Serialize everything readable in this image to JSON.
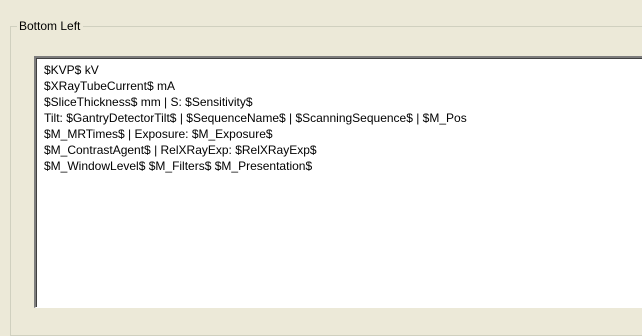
{
  "groupbox": {
    "caption": "Bottom Left"
  },
  "editor": {
    "lines": [
      "$KVP$ kV",
      "$XRayTubeCurrent$ mA",
      "$SliceThickness$ mm | S: $Sensitivity$",
      "Tilt: $GantryDetectorTilt$ | $SequenceName$ | $ScanningSequence$ | $M_Pos",
      "$M_MRTimes$ | Exposure: $M_Exposure$",
      "$M_ContrastAgent$ | RelXRayExp: $RelXRayExp$",
      "$M_WindowLevel$ $M_Filters$ $M_Presentation$"
    ]
  }
}
